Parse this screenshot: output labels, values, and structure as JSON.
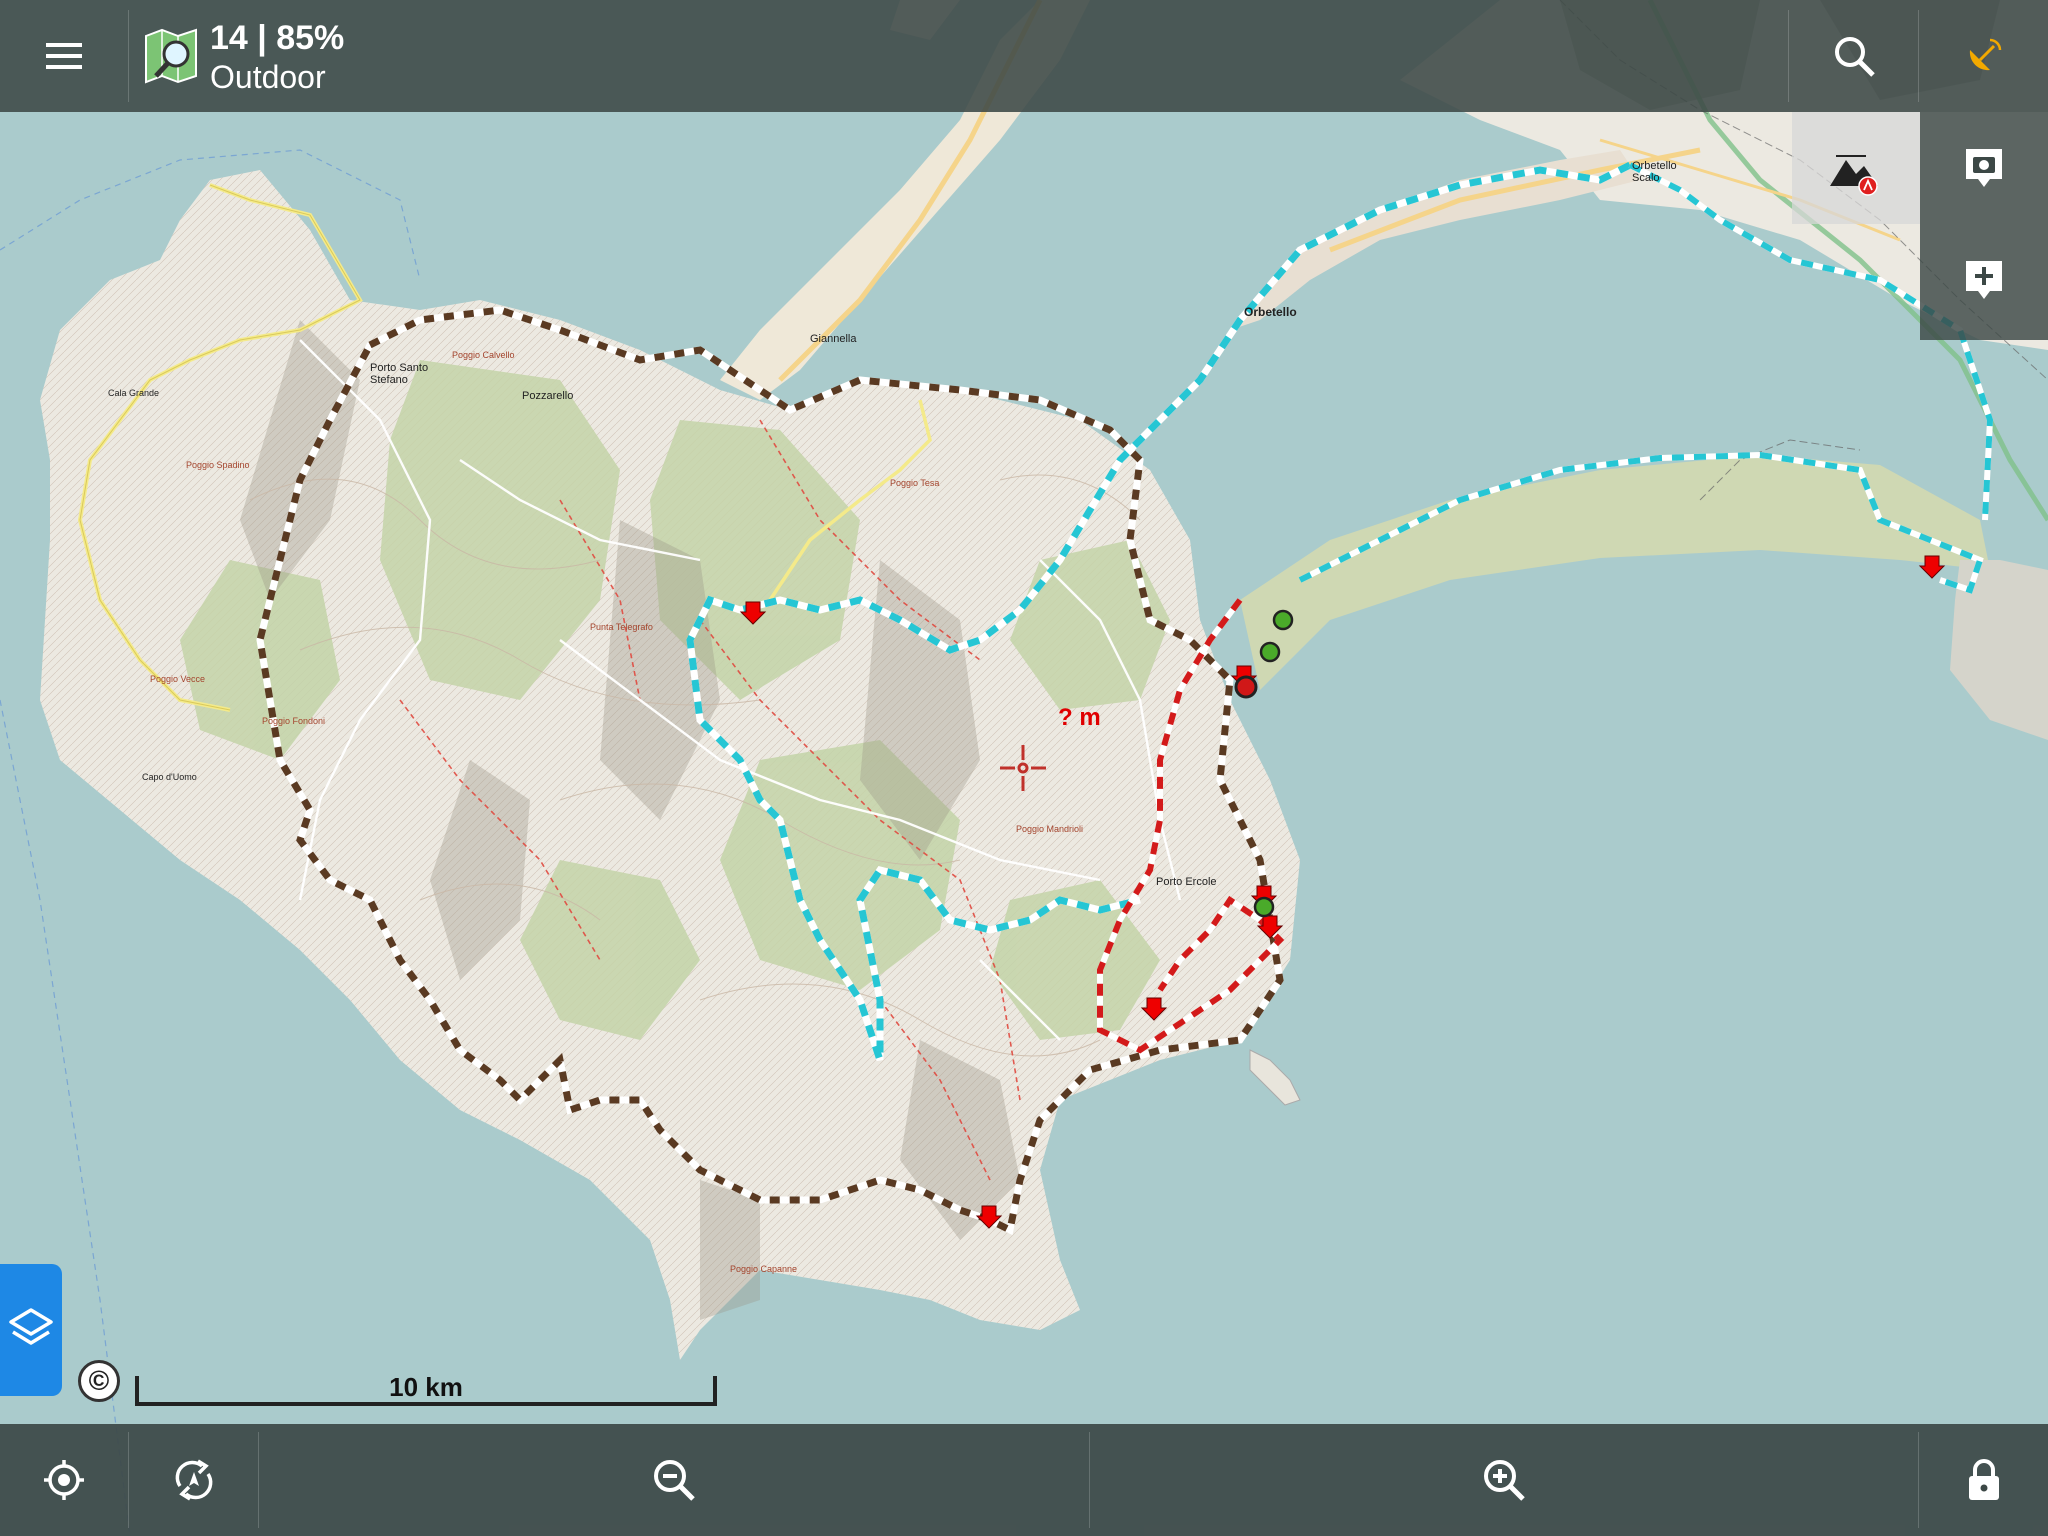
{
  "topbar": {
    "zoom_battery": "14 | 85%",
    "map_name": "Outdoor",
    "menu_icon": "menu-icon",
    "map_icon": "map-globe-icon",
    "search_icon": "search-icon",
    "gps_icon": "satellite-dish-icon"
  },
  "side": {
    "camera_icon": "camera-icon",
    "add_icon": "add-point-icon",
    "aux_icon": "terrain-warning-icon"
  },
  "bottombar": {
    "locate_icon": "my-location-icon",
    "rotate_icon": "map-rotation-icon",
    "zoom_out_icon": "zoom-out-icon",
    "zoom_in_icon": "zoom-in-icon",
    "lock_icon": "lock-icon"
  },
  "layers_icon": "layers-icon",
  "copyright": "©",
  "scale": {
    "label": "10 km"
  },
  "cursor": {
    "label": "? m"
  },
  "places": {
    "orbetello": "Orbetello",
    "orbetello_scalo": "Orbetello Scalo",
    "giannella": "Giannella",
    "porto_santo_stefano": "Porto Santo Stefano",
    "pozzarello": "Pozzarello",
    "porto_ercole": "Porto Ercole",
    "cala_grande": "Cala Grande",
    "capo_uomo": "Capo d'Uomo",
    "poggio_vecce": "Poggio Vecce",
    "poggio_tesa": "Poggio Tesa",
    "poggio_spadino": "Poggio Spadino",
    "poggio_calvello": "Poggio Calvello",
    "poggio_fondoni": "Poggio Fondoni",
    "monte_argentario": "Punta Telegrafo",
    "poggio_mandrioli": "Poggio Mandrioli",
    "poggio_capanne": "Poggio Capanne"
  },
  "colors": {
    "sea": "#aacbcc",
    "land": "#ece9e1",
    "forest": "#c8d7ae",
    "route_brown": "#5a3a22",
    "route_cyan": "#26c6d4",
    "route_red": "#d31a1a",
    "topbar": "#3c4846",
    "layers_button": "#1e88e5"
  }
}
